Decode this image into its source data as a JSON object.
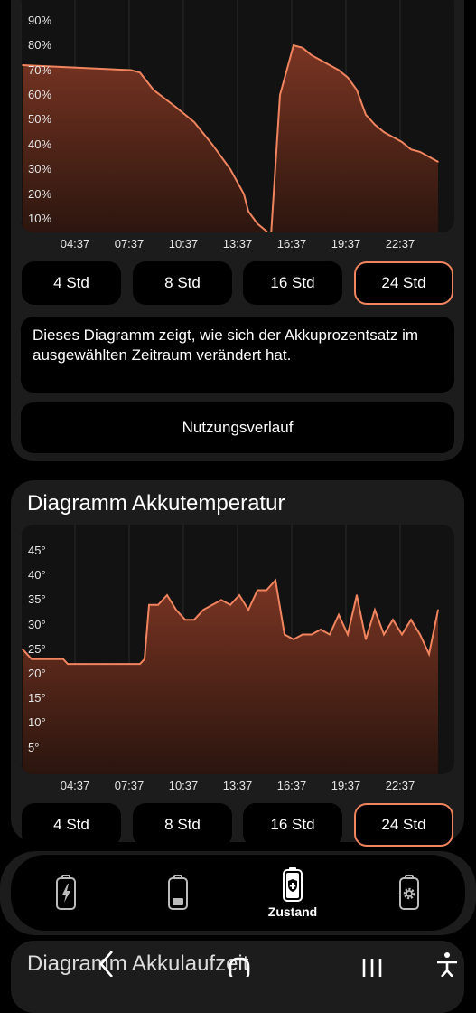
{
  "level_chart": {
    "y_ticks": [
      "90%",
      "80%",
      "70%",
      "60%",
      "50%",
      "40%",
      "30%",
      "20%",
      "10%"
    ],
    "x_ticks": [
      "04:37",
      "07:37",
      "10:37",
      "13:37",
      "16:37",
      "19:37",
      "22:37"
    ],
    "range_buttons": [
      "4 Std",
      "8 Std",
      "16 Std",
      "24 Std"
    ],
    "selected_range": "24 Std",
    "description": "Dieses Diagramm zeigt, wie sich der Akkuprozentsatz im ausgewählten Zeitraum verändert hat.",
    "history_button": "Nutzungsverlauf"
  },
  "temperature_card": {
    "title": "Diagramm Akkutemperatur",
    "y_ticks": [
      "45°",
      "40°",
      "35°",
      "30°",
      "25°",
      "20°",
      "15°",
      "10°",
      "5°"
    ],
    "x_ticks": [
      "04:37",
      "07:37",
      "10:37",
      "13:37",
      "16:37",
      "19:37",
      "22:37"
    ],
    "range_buttons": [
      "4 Std",
      "8 Std",
      "16 Std",
      "24 Std"
    ],
    "selected_range": "24 Std"
  },
  "next_card": {
    "title": "Diagramm Akkulaufzeit"
  },
  "bottom_nav": {
    "items": [
      {
        "icon": "battery-charging-icon",
        "label": ""
      },
      {
        "icon": "battery-level-icon",
        "label": ""
      },
      {
        "icon": "battery-shield-icon",
        "label": "Zustand"
      },
      {
        "icon": "battery-gear-icon",
        "label": ""
      }
    ]
  },
  "colors": {
    "accent": "#f0845f",
    "card": "#1c1c1c",
    "plot_bg": "#121212"
  },
  "chart_data": [
    {
      "type": "area",
      "ylabel": "",
      "ylim": [
        0,
        95
      ],
      "x_ticks": [
        "04:37",
        "07:37",
        "10:37",
        "13:37",
        "16:37",
        "19:37",
        "22:37"
      ],
      "series": [
        {
          "x": [
            "03:37",
            "06:37",
            "09:37",
            "10:07",
            "10:52",
            "12:07",
            "13:07",
            "14:07",
            "15:07",
            "15:52",
            "16:07",
            "16:37",
            "17:07",
            "17:22",
            "17:52",
            "18:37",
            "19:07",
            "19:37",
            "20:07",
            "20:37",
            "21:07",
            "21:37",
            "22:07",
            "22:37",
            "23:07",
            "23:37",
            "00:07",
            "00:37",
            "01:07",
            "01:37",
            "02:37"
          ],
          "y": [
            72,
            71,
            70,
            69,
            62,
            55,
            49,
            40,
            30,
            20,
            13,
            8,
            5,
            3,
            60,
            80,
            79,
            76,
            74,
            72,
            70,
            67,
            62,
            52,
            48,
            45,
            43,
            41,
            38,
            37,
            33
          ]
        }
      ]
    },
    {
      "type": "area",
      "ylabel": "",
      "ylim": [
        0,
        48
      ],
      "x_ticks": [
        "04:37",
        "07:37",
        "10:37",
        "13:37",
        "16:37",
        "19:37",
        "22:37"
      ],
      "series": [
        {
          "x": [
            "03:37",
            "04:07",
            "05:07",
            "05:52",
            "06:07",
            "07:07",
            "08:07",
            "09:07",
            "10:07",
            "10:22",
            "10:37",
            "11:07",
            "11:37",
            "12:07",
            "12:37",
            "13:07",
            "13:37",
            "14:07",
            "14:37",
            "15:07",
            "15:37",
            "16:07",
            "16:37",
            "17:07",
            "17:37",
            "18:07",
            "18:37",
            "19:07",
            "19:37",
            "20:07",
            "20:37",
            "21:07",
            "21:37",
            "22:07",
            "22:37",
            "23:07",
            "23:37",
            "00:07",
            "00:37",
            "01:07",
            "01:37",
            "02:07",
            "02:37"
          ],
          "y": [
            25,
            23,
            23,
            23,
            22,
            22,
            22,
            22,
            22,
            23,
            34,
            34,
            36,
            33,
            31,
            31,
            33,
            34,
            35,
            34,
            36,
            33,
            37,
            37,
            39,
            28,
            27,
            28,
            28,
            29,
            28,
            32,
            28,
            36,
            27,
            33,
            28,
            31,
            28,
            31,
            28,
            24,
            33
          ]
        }
      ]
    }
  ]
}
